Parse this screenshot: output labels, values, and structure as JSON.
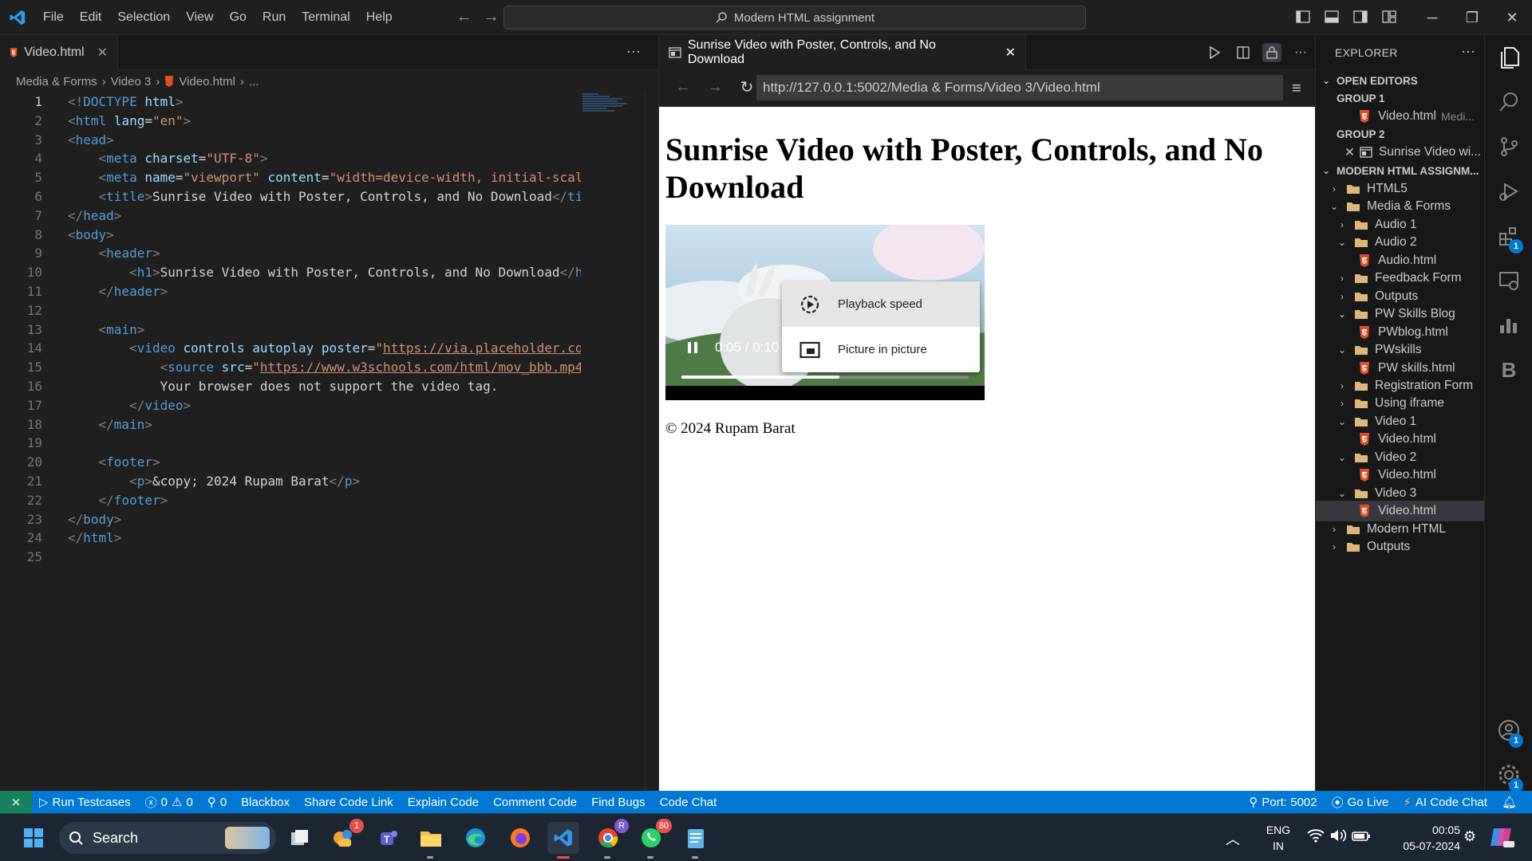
{
  "titlebar": {
    "menus": [
      "File",
      "Edit",
      "Selection",
      "View",
      "Go",
      "Run",
      "Terminal",
      "Help"
    ],
    "search": "Modern HTML assignment"
  },
  "editor": {
    "tab_label": "Video.html",
    "breadcrumb": [
      "Media & Forms",
      "Video 3",
      "Video.html",
      "..."
    ],
    "lines": [
      [
        [
          "pu",
          "<!"
        ],
        [
          "tg",
          "DOCTYPE"
        ],
        [
          "tx",
          " "
        ],
        [
          "at",
          "html"
        ],
        [
          "pu",
          ">"
        ]
      ],
      [
        [
          "pu",
          "<"
        ],
        [
          "tg",
          "html"
        ],
        [
          "tx",
          " "
        ],
        [
          "at",
          "lang"
        ],
        [
          "tx",
          "="
        ],
        [
          "st",
          "\"en\""
        ],
        [
          "pu",
          ">"
        ]
      ],
      [
        [
          "pu",
          "<"
        ],
        [
          "tg",
          "head"
        ],
        [
          "pu",
          ">"
        ]
      ],
      [
        [
          "tx",
          "    "
        ],
        [
          "pu",
          "<"
        ],
        [
          "tg",
          "meta"
        ],
        [
          "tx",
          " "
        ],
        [
          "at",
          "charset"
        ],
        [
          "tx",
          "="
        ],
        [
          "st",
          "\"UTF-8\""
        ],
        [
          "pu",
          ">"
        ]
      ],
      [
        [
          "tx",
          "    "
        ],
        [
          "pu",
          "<"
        ],
        [
          "tg",
          "meta"
        ],
        [
          "tx",
          " "
        ],
        [
          "at",
          "name"
        ],
        [
          "tx",
          "="
        ],
        [
          "st",
          "\"viewport\""
        ],
        [
          "tx",
          " "
        ],
        [
          "at",
          "content"
        ],
        [
          "tx",
          "="
        ],
        [
          "st",
          "\"width=device-width, initial-scal"
        ]
      ],
      [
        [
          "tx",
          "    "
        ],
        [
          "pu",
          "<"
        ],
        [
          "tg",
          "title"
        ],
        [
          "pu",
          ">"
        ],
        [
          "tx",
          "Sunrise Video with Poster, Controls, and No Download"
        ],
        [
          "pu",
          "</"
        ],
        [
          "tg",
          "ti"
        ]
      ],
      [
        [
          "pu",
          "</"
        ],
        [
          "tg",
          "head"
        ],
        [
          "pu",
          ">"
        ]
      ],
      [
        [
          "pu",
          "<"
        ],
        [
          "tg",
          "body"
        ],
        [
          "pu",
          ">"
        ]
      ],
      [
        [
          "tx",
          "    "
        ],
        [
          "pu",
          "<"
        ],
        [
          "tg",
          "header"
        ],
        [
          "pu",
          ">"
        ]
      ],
      [
        [
          "tx",
          "        "
        ],
        [
          "pu",
          "<"
        ],
        [
          "tg",
          "h1"
        ],
        [
          "pu",
          ">"
        ],
        [
          "tx",
          "Sunrise Video with Poster, Controls, and No Download"
        ],
        [
          "pu",
          "</"
        ],
        [
          "tg",
          "h"
        ]
      ],
      [
        [
          "tx",
          "    "
        ],
        [
          "pu",
          "</"
        ],
        [
          "tg",
          "header"
        ],
        [
          "pu",
          ">"
        ]
      ],
      [],
      [
        [
          "tx",
          "    "
        ],
        [
          "pu",
          "<"
        ],
        [
          "tg",
          "main"
        ],
        [
          "pu",
          ">"
        ]
      ],
      [
        [
          "tx",
          "        "
        ],
        [
          "pu",
          "<"
        ],
        [
          "tg",
          "video"
        ],
        [
          "tx",
          " "
        ],
        [
          "at",
          "controls"
        ],
        [
          "tx",
          " "
        ],
        [
          "at",
          "autoplay"
        ],
        [
          "tx",
          " "
        ],
        [
          "at",
          "poster"
        ],
        [
          "tx",
          "="
        ],
        [
          "st",
          "\""
        ],
        [
          "lk",
          "https://via.placeholder.co"
        ]
      ],
      [
        [
          "tx",
          "            "
        ],
        [
          "pu",
          "<"
        ],
        [
          "tg",
          "source"
        ],
        [
          "tx",
          " "
        ],
        [
          "at",
          "src"
        ],
        [
          "tx",
          "="
        ],
        [
          "st",
          "\""
        ],
        [
          "lk",
          "https://www.w3schools.com/html/mov_bbb.mp4"
        ]
      ],
      [
        [
          "tx",
          "            Your browser does not support the video tag."
        ]
      ],
      [
        [
          "tx",
          "        "
        ],
        [
          "pu",
          "</"
        ],
        [
          "tg",
          "video"
        ],
        [
          "pu",
          ">"
        ]
      ],
      [
        [
          "tx",
          "    "
        ],
        [
          "pu",
          "</"
        ],
        [
          "tg",
          "main"
        ],
        [
          "pu",
          ">"
        ]
      ],
      [],
      [
        [
          "tx",
          "    "
        ],
        [
          "pu",
          "<"
        ],
        [
          "tg",
          "footer"
        ],
        [
          "pu",
          ">"
        ]
      ],
      [
        [
          "tx",
          "        "
        ],
        [
          "pu",
          "<"
        ],
        [
          "tg",
          "p"
        ],
        [
          "pu",
          ">"
        ],
        [
          "tx",
          "&copy; 2024 Rupam Barat"
        ],
        [
          "pu",
          "</"
        ],
        [
          "tg",
          "p"
        ],
        [
          "pu",
          ">"
        ]
      ],
      [
        [
          "tx",
          "    "
        ],
        [
          "pu",
          "</"
        ],
        [
          "tg",
          "footer"
        ],
        [
          "pu",
          ">"
        ]
      ],
      [
        [
          "pu",
          "</"
        ],
        [
          "tg",
          "body"
        ],
        [
          "pu",
          ">"
        ]
      ],
      [
        [
          "pu",
          "</"
        ],
        [
          "tg",
          "html"
        ],
        [
          "pu",
          ">"
        ]
      ],
      []
    ]
  },
  "preview": {
    "tab_label": "Sunrise Video with Poster, Controls, and No Download",
    "url": "http://127.0.0.1:5002/Media & Forms/Video 3/Video.html",
    "heading": "Sunrise Video with Poster, Controls, and No Download",
    "video_time": "0:05 / 0:10",
    "video_progress": 0.55,
    "menu": {
      "speed": "Playback speed",
      "pip": "Picture in picture"
    },
    "footer": "© 2024 Rupam Barat"
  },
  "explorer": {
    "title": "EXPLORER",
    "open_editors": "OPEN EDITORS",
    "group1": "GROUP 1",
    "group1_file": "Video.html",
    "group1_file_hint": "Medi...",
    "group2": "GROUP 2",
    "group2_file": "Sunrise Video wi...",
    "workspace": "MODERN HTML ASSIGNM...",
    "tree": [
      {
        "label": "HTML5",
        "type": "folder",
        "depth": 1,
        "open": false
      },
      {
        "label": "Media & Forms",
        "type": "folder",
        "depth": 1,
        "open": true
      },
      {
        "label": "Audio 1",
        "type": "folder",
        "depth": 2,
        "open": false
      },
      {
        "label": "Audio 2",
        "type": "folder",
        "depth": 2,
        "open": true
      },
      {
        "label": "Audio.html",
        "type": "file",
        "depth": 3
      },
      {
        "label": "Feedback Form",
        "type": "folder",
        "depth": 2,
        "open": false
      },
      {
        "label": "Outputs",
        "type": "folder",
        "depth": 2,
        "open": false
      },
      {
        "label": "PW Skills Blog",
        "type": "folder",
        "depth": 2,
        "open": true
      },
      {
        "label": "PWblog.html",
        "type": "file",
        "depth": 3
      },
      {
        "label": "PWskills",
        "type": "folder",
        "depth": 2,
        "open": true
      },
      {
        "label": "PW skills.html",
        "type": "file",
        "depth": 3
      },
      {
        "label": "Registration Form",
        "type": "folder",
        "depth": 2,
        "open": false
      },
      {
        "label": "Using iframe",
        "type": "folder",
        "depth": 2,
        "open": false
      },
      {
        "label": "Video 1",
        "type": "folder",
        "depth": 2,
        "open": true
      },
      {
        "label": "Video.html",
        "type": "file",
        "depth": 3
      },
      {
        "label": "Video 2",
        "type": "folder",
        "depth": 2,
        "open": true
      },
      {
        "label": "Video.html",
        "type": "file",
        "depth": 3
      },
      {
        "label": "Video 3",
        "type": "folder",
        "depth": 2,
        "open": true
      },
      {
        "label": "Video.html",
        "type": "file",
        "depth": 3,
        "selected": true
      },
      {
        "label": "Modern HTML",
        "type": "folder",
        "depth": 1,
        "open": false
      },
      {
        "label": "Outputs",
        "type": "folder",
        "depth": 1,
        "open": false
      }
    ]
  },
  "activity": {
    "extensions_badge": "1",
    "accounts_badge": "1",
    "settings_badge": "1",
    "bito_label": "B"
  },
  "statusbar": {
    "left": [
      "Run Testcases",
      "0",
      "0",
      "0",
      "Blackbox",
      "Share Code Link",
      "Explain Code",
      "Comment Code",
      "Find Bugs",
      "Code Chat"
    ],
    "right": [
      "Port: 5002",
      "Go Live",
      "AI Code Chat"
    ]
  },
  "taskbar": {
    "search": "Search",
    "badges": {
      "tasks": "1",
      "whatsapp": "80",
      "chrome_profile": "R"
    },
    "lang": [
      "ENG",
      "IN"
    ],
    "time": "00:05",
    "date": "05-07-2024"
  },
  "colors": {
    "accent": "#0078d4",
    "html_icon": "#e44d26",
    "folder": "#dcb67a"
  }
}
